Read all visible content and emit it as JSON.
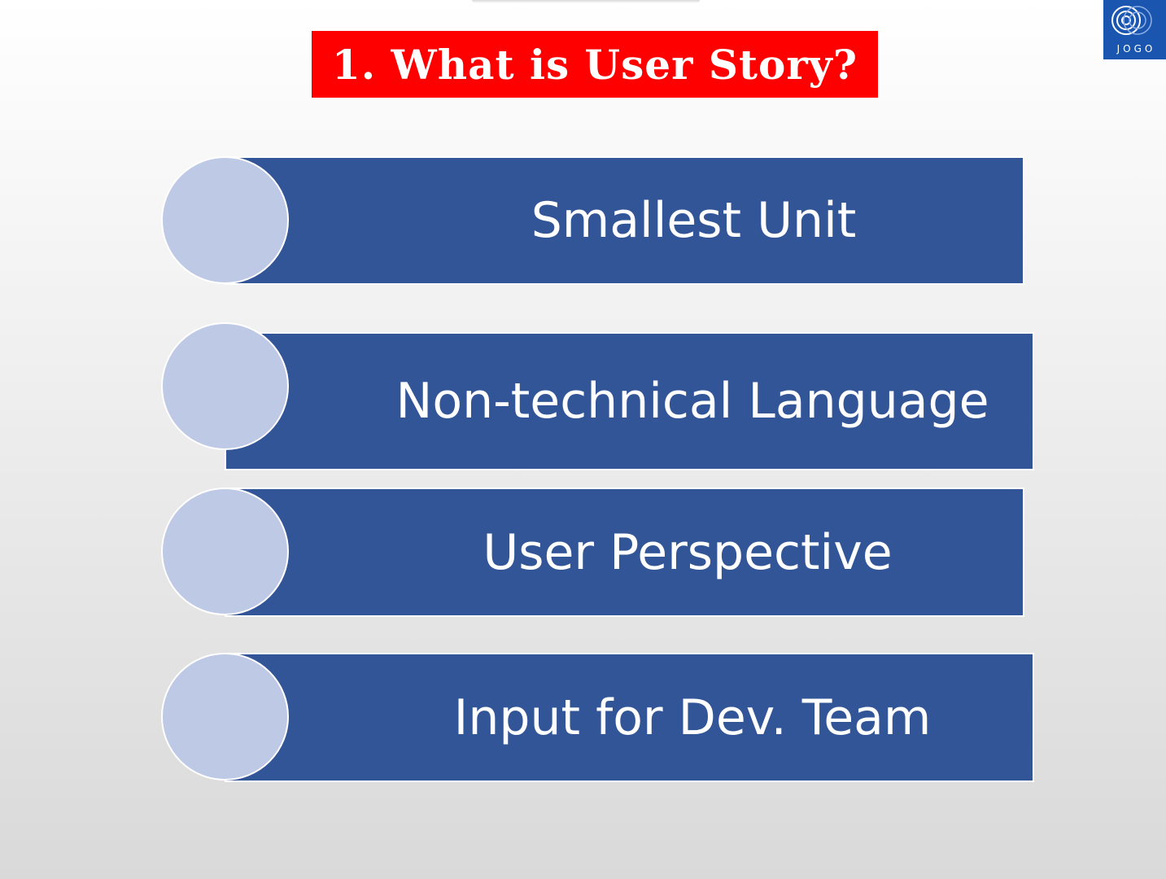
{
  "slide": {
    "title": "1. What is User Story?",
    "logo_text": "JOGO",
    "colors": {
      "title_background": "#ff0000",
      "bar_fill": "#325598",
      "circle_fill": "#bec9e5",
      "logo_background": "#1a56b0"
    },
    "items": [
      {
        "label": "Smallest Unit"
      },
      {
        "label": "Non-technical Language"
      },
      {
        "label": "User Perspective"
      },
      {
        "label": "Input for Dev. Team"
      }
    ]
  }
}
